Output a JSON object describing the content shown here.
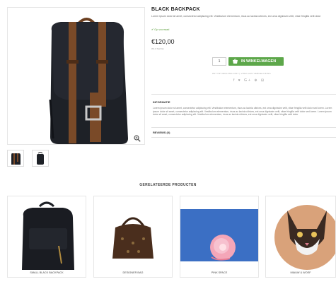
{
  "product": {
    "title": "BLACK BACKPACK",
    "description": "Lorem ipsum dolor sit amet, consectetur adipiscing elit. Vestibulum elementum, risus ac lacinia ultrices, est urna dignissim velit, vitae fringilla velit dolor",
    "stock_status": "✔ Op voorraad",
    "price": "€120,00",
    "vat_note": "0% 0 Tax/Vat",
    "quantity": "1",
    "cart_button_label": "IN WINKELWAGEN",
    "wishlist_link": "ZET OP VERLANGLIJST | VOEG AAN VERGELIJKING",
    "share_icons": "f  ♥  G+  ⊕  ⊟"
  },
  "info_section": {
    "heading": "INFORMATIE",
    "text": "Lorem ipsum dolor sit amet, consectetur adipiscing elit. Vestibulum elementum, risus ac lacinia ultrices, est urna dignissim velit, vitae fringilla velit dolor sed lorem. Lorem ipsum dolor sit amet, consectetur adipiscing elit. Vestibulum elementum, risus ac lacinia ultrices, est urna dignissim velit, vitae fringilla velit dolor sed lorem. Lorem ipsum dolor sit amet, consectetur adipiscing elit. Vestibulum elementum, risus ac lacinia ultrices, est urna dignissim velit, vitae fringilla velit dolor"
  },
  "reviews_heading": "REVIEWS (0)",
  "related": {
    "heading": "GERELATEERDE PRODUCTEN",
    "items": [
      {
        "label": "SMALL BLACK BACKPACK"
      },
      {
        "label": "DESIGNER BAG"
      },
      {
        "label": "PINK SPACE"
      },
      {
        "label": "MIAUW & WOEF"
      }
    ]
  },
  "icons": {
    "zoom": "zoom-icon",
    "cart": "cart-icon"
  },
  "colors": {
    "cart_button": "#5da74a",
    "stock": "#5a9e3a"
  }
}
